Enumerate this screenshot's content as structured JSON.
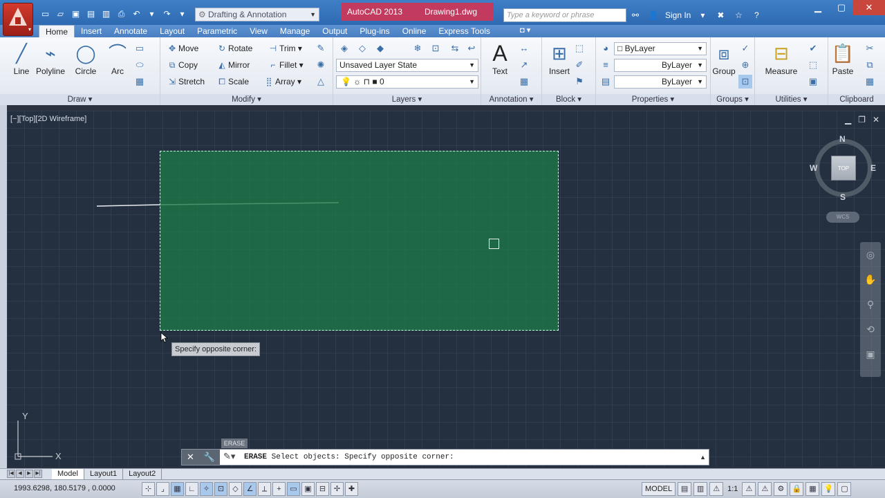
{
  "titlebar": {
    "workspace": "Drafting & Annotation",
    "app_name": "AutoCAD 2013",
    "doc_name": "Drawing1.dwg",
    "search_placeholder": "Type a keyword or phrase",
    "sign_in": "Sign In",
    "help_label": "?"
  },
  "ribbon_tabs": [
    "Home",
    "Insert",
    "Annotate",
    "Layout",
    "Parametric",
    "View",
    "Manage",
    "Output",
    "Plug-ins",
    "Online",
    "Express Tools"
  ],
  "ribbon": {
    "draw": {
      "title": "Draw ▾",
      "line": "Line",
      "polyline": "Polyline",
      "circle": "Circle",
      "arc": "Arc"
    },
    "modify": {
      "title": "Modify ▾",
      "move": "Move",
      "rotate": "Rotate",
      "trim": "Trim",
      "copy": "Copy",
      "mirror": "Mirror",
      "fillet": "Fillet",
      "stretch": "Stretch",
      "scale": "Scale",
      "array": "Array"
    },
    "layers": {
      "title": "Layers ▾",
      "layer_state": "Unsaved Layer State",
      "current_layer": "0"
    },
    "annotation": {
      "title": "Annotation ▾",
      "text": "Text"
    },
    "block": {
      "title": "Block ▾",
      "insert": "Insert"
    },
    "properties": {
      "title": "Properties ▾",
      "color": "ByLayer",
      "linetype": "ByLayer",
      "lineweight": "ByLayer"
    },
    "groups": {
      "title": "Groups ▾",
      "group": "Group"
    },
    "utilities": {
      "title": "Utilities ▾",
      "measure": "Measure"
    },
    "clipboard": {
      "title": "Clipboard",
      "paste": "Paste"
    }
  },
  "viewport": {
    "label": "[−][Top][2D Wireframe]",
    "tooltip": "Specify opposite corner:",
    "viewcube": {
      "face": "TOP",
      "n": "N",
      "s": "S",
      "e": "E",
      "w": "W",
      "wcs": "WCS"
    },
    "ucs": {
      "x": "X",
      "y": "Y"
    }
  },
  "command": {
    "tag": "ERASE",
    "name": "ERASE",
    "text": " Select objects: Specify opposite corner:"
  },
  "layout_tabs": [
    "Model",
    "Layout1",
    "Layout2"
  ],
  "statusbar": {
    "coords": "1993.6298, 180.5179 , 0.0000",
    "model": "MODEL",
    "annotation_scale": "1:1"
  },
  "colors": {
    "selection_fill": "#1e7846",
    "drawing_bg": "#243040",
    "title_tab": "#c23a5e"
  }
}
